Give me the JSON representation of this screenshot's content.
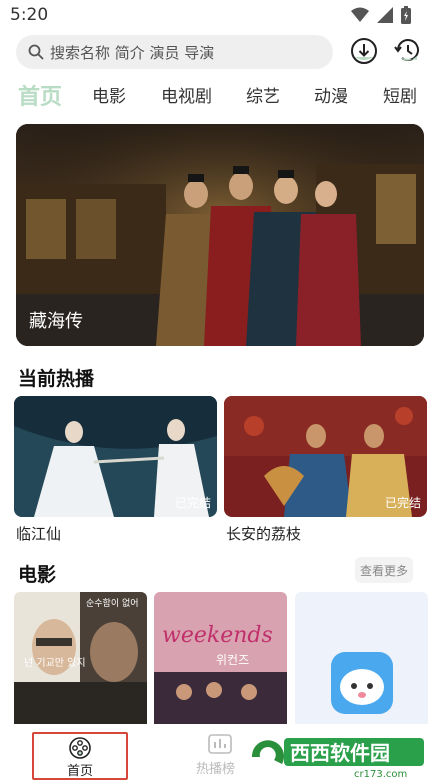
{
  "status": {
    "time": "5:20"
  },
  "search": {
    "placeholder": "搜索名称 简介 演员 导演"
  },
  "tabs": [
    {
      "label": "首页",
      "active": true
    },
    {
      "label": "电影"
    },
    {
      "label": "电视剧"
    },
    {
      "label": "综艺"
    },
    {
      "label": "动漫"
    },
    {
      "label": "短剧"
    }
  ],
  "banner": {
    "title": "藏海传"
  },
  "now_playing": {
    "title": "当前热播",
    "items": [
      {
        "title": "临江仙",
        "badge": "已完结"
      },
      {
        "title": "长安的荔枝",
        "badge": "已完结"
      }
    ]
  },
  "movies": {
    "title": "电影",
    "more_label": "查看更多",
    "posters": [
      {
        "overlay_text_top": "순수함이 없어",
        "overlay_text_mid": "넌 기교만 있지"
      },
      {
        "overlay_text": "위컨즈",
        "overlay_script": "weekends"
      }
    ]
  },
  "bottom_nav": {
    "home_label": "首页",
    "hot_label": "热播榜"
  },
  "watermark": {
    "text": "西西软件园",
    "url": "cr173.com"
  },
  "colors": {
    "accent": "#b9dcc5",
    "highlight_border": "#d8463a"
  }
}
